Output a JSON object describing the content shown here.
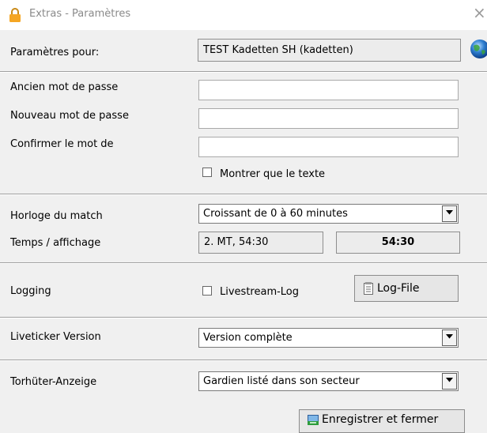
{
  "window": {
    "title": "Extras - Paramètres",
    "close_glyph": "×"
  },
  "settings_for": {
    "label": "Paramètres pour:",
    "value": "TEST Kadetten SH (kadetten)"
  },
  "password": {
    "old_label": "Ancien mot de passe",
    "old_value": "",
    "new_label": "Nouveau mot de passe",
    "new_value": "",
    "confirm_label": "Confirmer le mot de",
    "confirm_value": "",
    "show_text_label": "Montrer que le texte",
    "show_text_checked": false
  },
  "match_clock": {
    "label": "Horloge du match",
    "selected": "Croissant de 0 à 60 minutes",
    "display_label": "Temps / affichage",
    "time_text": "2. MT, 54:30",
    "time_bold": "54:30"
  },
  "logging": {
    "label": "Logging",
    "livestream_label": "Livestream-Log",
    "livestream_checked": false,
    "logfile_button": "Log-File"
  },
  "liveticker": {
    "label": "Liveticker Version",
    "selected": "Version complète"
  },
  "goalkeeper": {
    "label": "Torhüter-Anzeige",
    "selected": "Gardien listé dans son secteur"
  },
  "footer": {
    "save_button": "Enregistrer et fermer"
  },
  "icons": {
    "lock": "lock-icon",
    "globe": "globe-icon",
    "notepad": "notepad-icon",
    "save": "save-icon",
    "dropdown": "chevron-down-icon"
  },
  "colors": {
    "window_bg": "#f0f0f0",
    "titlebar_bg": "#ffffff",
    "lock_orange": "#f5a623"
  }
}
